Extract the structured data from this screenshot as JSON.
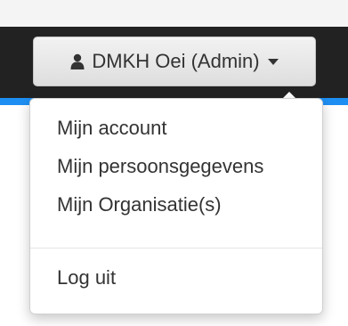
{
  "navbar": {
    "user_button": {
      "icon": "user-icon",
      "label": "DMKH Oei (Admin)",
      "caret_icon": "caret-down-icon"
    }
  },
  "colors": {
    "navbar_bg": "#222222",
    "accent": "#1e8ff2",
    "menu_text": "#333333"
  },
  "dropdown": {
    "items": [
      {
        "label": "Mijn account"
      },
      {
        "label": "Mijn persoonsgegevens"
      },
      {
        "label": "Mijn Organisatie(s)"
      }
    ],
    "logout_label": "Log uit"
  }
}
